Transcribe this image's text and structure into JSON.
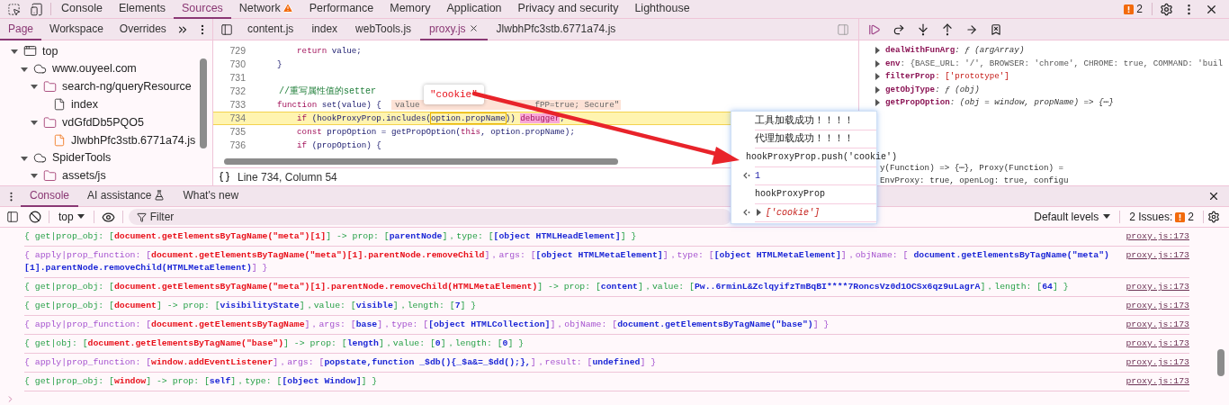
{
  "top_tabs": [
    {
      "label": "Console",
      "selected": false,
      "warning": false
    },
    {
      "label": "Elements",
      "selected": false,
      "warning": false
    },
    {
      "label": "Sources",
      "selected": true,
      "warning": false
    },
    {
      "label": "Network",
      "selected": false,
      "warning": true
    },
    {
      "label": "Performance",
      "selected": false,
      "warning": false
    },
    {
      "label": "Memory",
      "selected": false,
      "warning": false
    },
    {
      "label": "Application",
      "selected": false,
      "warning": false
    },
    {
      "label": "Privacy and security",
      "selected": false,
      "warning": false
    },
    {
      "label": "Lighthouse",
      "selected": false,
      "warning": false
    }
  ],
  "issues_count": "2",
  "navigator": {
    "tabs": [
      {
        "label": "Page",
        "selected": true
      },
      {
        "label": "Workspace",
        "selected": false
      },
      {
        "label": "Overrides",
        "selected": false
      }
    ],
    "tree": [
      {
        "label": "top",
        "kind": "frame",
        "expanded": true,
        "children": [
          {
            "label": "www.ouyeel.com",
            "kind": "domain",
            "expanded": true,
            "children": [
              {
                "label": "search-ng/queryResource",
                "kind": "folder",
                "expanded": true,
                "children": [
                  {
                    "label": "index",
                    "kind": "file"
                  }
                ]
              },
              {
                "label": "vdGfdDb5PQO5",
                "kind": "folder",
                "expanded": true,
                "children": [
                  {
                    "label": "JlwbhPfc3stb.6771a74.js",
                    "kind": "script"
                  }
                ]
              }
            ]
          },
          {
            "label": "SpiderTools",
            "kind": "domain",
            "expanded": true,
            "children": [
              {
                "label": "assets/js",
                "kind": "folder",
                "expanded": true
              }
            ]
          }
        ]
      }
    ]
  },
  "editor": {
    "tabs": [
      {
        "label": "content.js",
        "selected": false,
        "closable": false
      },
      {
        "label": "index",
        "selected": false,
        "closable": false
      },
      {
        "label": "webTools.js",
        "selected": false,
        "closable": false
      },
      {
        "label": "proxy.js",
        "selected": true,
        "closable": true
      },
      {
        "label": "JlwbhPfc3stb.6771a74.js",
        "selected": false,
        "closable": false
      }
    ],
    "lines": [
      {
        "number": "729",
        "highlighted": false,
        "parts": [
          {
            "text": "        return",
            "kind": "keyword"
          },
          {
            "text": " value;",
            "kind": "plain"
          }
        ]
      },
      {
        "number": "730",
        "highlighted": false,
        "parts": [
          {
            "text": "    }",
            "kind": "plain"
          }
        ]
      },
      {
        "number": "731",
        "highlighted": false
      },
      {
        "number": "732",
        "highlighted": false,
        "parts": [
          {
            "text": "    //重写属性值的setter",
            "kind": "comment"
          }
        ]
      },
      {
        "number": "733",
        "highlighted": false,
        "parts": [
          {
            "text": "    function",
            "kind": "keyword"
          },
          {
            "text": " set(value) {  ",
            "kind": "plain"
          },
          {
            "text": "value",
            "kind": "inline"
          },
          {
            "text": "fPP=true; Secure\"",
            "kind": "inline-tail"
          }
        ]
      },
      {
        "number": "734",
        "highlighted": true,
        "parts": [
          {
            "text": "        if",
            "kind": "keyword"
          },
          {
            "text": " (hookProxyProp.includes(",
            "kind": "plain"
          },
          {
            "text": "option.propName",
            "kind": "boxed"
          },
          {
            "text": ")) ",
            "kind": "plain"
          },
          {
            "text": "debugger",
            "kind": "debugger"
          },
          {
            "text": ";",
            "kind": "plain"
          }
        ]
      },
      {
        "number": "735",
        "highlighted": false,
        "parts": [
          {
            "text": "        const",
            "kind": "keyword"
          },
          {
            "text": " propOption = getPropOption(",
            "kind": "plain"
          },
          {
            "text": "this",
            "kind": "keyword"
          },
          {
            "text": ", option.propName);",
            "kind": "plain"
          }
        ]
      },
      {
        "number": "736",
        "highlighted": false,
        "parts": [
          {
            "text": "        if",
            "kind": "keyword"
          },
          {
            "text": " (propOption) {",
            "kind": "plain"
          }
        ]
      }
    ],
    "status": "Line 734, Column 54",
    "tooltip": "\"cookie\""
  },
  "scope": {
    "entries": [
      {
        "name": "dealWithFunArg",
        "value": ": ƒ (argArray)",
        "kind": "function"
      },
      {
        "name": "env",
        "value": ": {BASE_URL: '/', BROWSER: 'chrome', CHROME: true, COMMAND: 'buil",
        "kind": "object"
      },
      {
        "name": "filterProp",
        "value": ": ['prototype']",
        "kind": "array"
      },
      {
        "name": "getObjType",
        "value": ": ƒ (obj)",
        "kind": "function"
      },
      {
        "name": "getPropOption",
        "value": ": (obj = window, propName) => {⋯}",
        "kind": "function"
      }
    ],
    "fragments": [
      "y(Function) => {⋯}, Proxy(Function) =",
      "EnvProxy: true, openLog: true, configu"
    ]
  },
  "drawer": {
    "tabs": [
      {
        "label": "Console",
        "selected": true,
        "experimental": false
      },
      {
        "label": "AI assistance",
        "selected": false,
        "experimental": true
      },
      {
        "label": "What's new",
        "selected": false,
        "experimental": false
      }
    ]
  },
  "console_toolbar": {
    "context": "top",
    "filter_placeholder": "Filter",
    "levels": "Default levels",
    "issues_label": "2 Issues:",
    "issues_count": "2"
  },
  "logs": [
    {
      "kind": "get",
      "source": "proxy.js:173",
      "parts": [
        {
          "text": "{ get|prop_obj: [",
          "kind": "plain"
        },
        {
          "text": "document.getElementsByTagName(\"meta\")[1]",
          "kind": "target"
        },
        {
          "text": "] -> prop: [",
          "kind": "plain"
        },
        {
          "text": "parentNode",
          "kind": "value"
        },
        {
          "text": "]，type: [",
          "kind": "plain"
        },
        {
          "text": "[object HTMLHeadElement]",
          "kind": "value"
        },
        {
          "text": "] }",
          "kind": "plain"
        }
      ]
    },
    {
      "kind": "apply",
      "source": "proxy.js:173",
      "parts": [
        {
          "text": "{ apply|prop_function: [",
          "kind": "plain"
        },
        {
          "text": "document.getElementsByTagName(\"meta\")[1].parentNode.removeChild",
          "kind": "target"
        },
        {
          "text": "]，args: [",
          "kind": "plain"
        },
        {
          "text": "[object HTMLMetaElement]",
          "kind": "value"
        },
        {
          "text": "]，type: [",
          "kind": "plain"
        },
        {
          "text": "[object HTMLMetaElement]",
          "kind": "value"
        },
        {
          "text": "]，objName: [ ",
          "kind": "plain"
        },
        {
          "text": "document.getElementsByTagName(\"meta\")[1].parentNode.removeChild(HTMLMetaElement)",
          "kind": "value"
        },
        {
          "text": "] }",
          "kind": "plain"
        }
      ]
    },
    {
      "kind": "get",
      "source": "proxy.js:173",
      "parts": [
        {
          "text": "{ get|prop_obj: [",
          "kind": "plain"
        },
        {
          "text": "document.getElementsByTagName(\"meta\")[1].parentNode.removeChild(HTMLMetaElement)",
          "kind": "target"
        },
        {
          "text": "] -> prop: [",
          "kind": "plain"
        },
        {
          "text": "content",
          "kind": "value"
        },
        {
          "text": "]，value: [",
          "kind": "plain"
        },
        {
          "text": "Pw..6rminL&ZclqyifzTmBqBI****7RoncsVz0d1OCSx6qz9uLagrA",
          "kind": "value"
        },
        {
          "text": "]，length: [",
          "kind": "plain"
        },
        {
          "text": "64",
          "kind": "value"
        },
        {
          "text": "] }",
          "kind": "plain"
        }
      ]
    },
    {
      "kind": "get",
      "source": "proxy.js:173",
      "parts": [
        {
          "text": "{ get|prop_obj: [",
          "kind": "plain"
        },
        {
          "text": "document",
          "kind": "target"
        },
        {
          "text": "] -> prop: [",
          "kind": "plain"
        },
        {
          "text": "visibilityState",
          "kind": "value"
        },
        {
          "text": "]，value: [",
          "kind": "plain"
        },
        {
          "text": "visible",
          "kind": "value"
        },
        {
          "text": "]，length: [",
          "kind": "plain"
        },
        {
          "text": "7",
          "kind": "value"
        },
        {
          "text": "] }",
          "kind": "plain"
        }
      ]
    },
    {
      "kind": "apply",
      "source": "proxy.js:173",
      "parts": [
        {
          "text": "{ apply|prop_function: [",
          "kind": "plain"
        },
        {
          "text": "document.getElementsByTagName",
          "kind": "target"
        },
        {
          "text": "]，args: [",
          "kind": "plain"
        },
        {
          "text": "base",
          "kind": "value"
        },
        {
          "text": "]，type: [",
          "kind": "plain"
        },
        {
          "text": "[object HTMLCollection]",
          "kind": "value"
        },
        {
          "text": "]，objName: [",
          "kind": "plain"
        },
        {
          "text": "document.getElementsByTagName(\"base\")",
          "kind": "value"
        },
        {
          "text": "] }",
          "kind": "plain"
        }
      ]
    },
    {
      "kind": "get",
      "source": "proxy.js:173",
      "parts": [
        {
          "text": "{ get|obj: [",
          "kind": "plain"
        },
        {
          "text": "document.getElementsByTagName(\"base\")",
          "kind": "target"
        },
        {
          "text": "] -> prop: [",
          "kind": "plain"
        },
        {
          "text": "length",
          "kind": "value"
        },
        {
          "text": "]，value: [",
          "kind": "plain"
        },
        {
          "text": "0",
          "kind": "value"
        },
        {
          "text": "]，length: [",
          "kind": "plain"
        },
        {
          "text": "0",
          "kind": "value"
        },
        {
          "text": "] }",
          "kind": "plain"
        }
      ]
    },
    {
      "kind": "apply",
      "source": "proxy.js:173",
      "parts": [
        {
          "text": "{ apply|prop_function: [",
          "kind": "plain"
        },
        {
          "text": "window.addEventListener",
          "kind": "target"
        },
        {
          "text": "]，args: [",
          "kind": "plain"
        },
        {
          "text": "popstate,function _$db(){_$a&=_$dd();},",
          "kind": "value"
        },
        {
          "text": "]，result: [",
          "kind": "plain"
        },
        {
          "text": "undefined",
          "kind": "value"
        },
        {
          "text": "] }",
          "kind": "plain"
        }
      ]
    },
    {
      "kind": "get",
      "source": "proxy.js:173",
      "parts": [
        {
          "text": "{ get|prop_obj: [",
          "kind": "plain"
        },
        {
          "text": "window",
          "kind": "target"
        },
        {
          "text": "] -> prop: [",
          "kind": "plain"
        },
        {
          "text": "self",
          "kind": "value"
        },
        {
          "text": "]，type: [",
          "kind": "plain"
        },
        {
          "text": "[object Window]",
          "kind": "value"
        },
        {
          "text": "] }",
          "kind": "plain"
        }
      ]
    }
  ],
  "popup": {
    "entries": [
      {
        "text": "工具加载成功！！！！",
        "kind": "log"
      },
      {
        "text": "代理加载成功！！！！",
        "kind": "log"
      },
      {
        "text": "hookProxyProp.push('cookie')",
        "kind": "command"
      },
      {
        "text": "1",
        "kind": "result"
      },
      {
        "text": "hookProxyProp",
        "kind": "echo"
      },
      {
        "text": "['cookie']",
        "kind": "result-array"
      }
    ]
  }
}
